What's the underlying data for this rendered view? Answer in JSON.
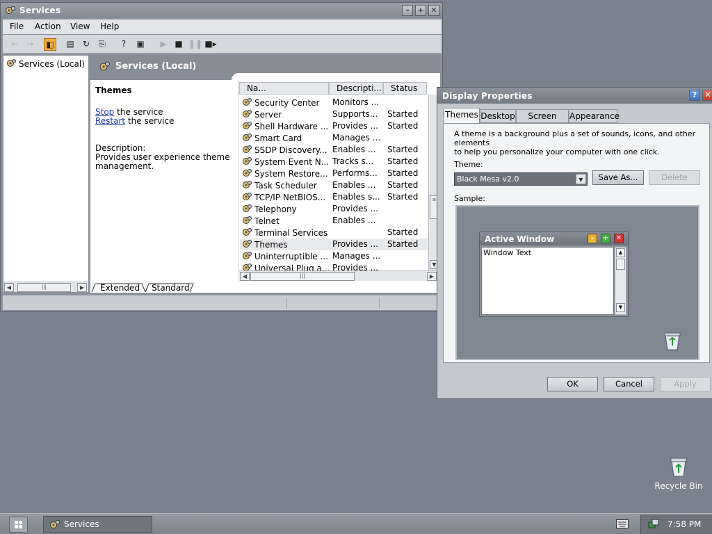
{
  "services": {
    "title": "Services",
    "menu": [
      "File",
      "Action",
      "View",
      "Help"
    ],
    "tree_root": "Services (Local)",
    "header_title": "Services (Local)",
    "detail": {
      "name": "Themes",
      "stop_link": "Stop",
      "stop_rest": " the service",
      "restart_link": "Restart",
      "restart_rest": " the service",
      "desc_label": "Description:",
      "desc_line1": "Provides user experience theme",
      "desc_line2": "management."
    },
    "columns": [
      "Na...",
      "Descripti...",
      "Status"
    ],
    "rows": [
      {
        "name": "Security Center",
        "desc": "Monitors ...",
        "status": ""
      },
      {
        "name": "Server",
        "desc": "Supports...",
        "status": "Started"
      },
      {
        "name": "Shell Hardware ...",
        "desc": "Provides ...",
        "status": "Started"
      },
      {
        "name": "Smart Card",
        "desc": "Manages ...",
        "status": ""
      },
      {
        "name": "SSDP Discovery...",
        "desc": "Enables ...",
        "status": "Started"
      },
      {
        "name": "System Event N...",
        "desc": "Tracks s...",
        "status": "Started"
      },
      {
        "name": "System Restore...",
        "desc": "Performs...",
        "status": "Started"
      },
      {
        "name": "Task Scheduler",
        "desc": "Enables ...",
        "status": "Started"
      },
      {
        "name": "TCP/IP NetBIOS...",
        "desc": "Enables s...",
        "status": "Started"
      },
      {
        "name": "Telephony",
        "desc": "Provides ...",
        "status": ""
      },
      {
        "name": "Telnet",
        "desc": "Enables ...",
        "status": ""
      },
      {
        "name": "Terminal Services",
        "desc": "",
        "status": "Started"
      },
      {
        "name": "Themes",
        "desc": "Provides ...",
        "status": "Started"
      },
      {
        "name": "Uninterruptible ...",
        "desc": "Manages ...",
        "status": ""
      },
      {
        "name": "Universal Plug a...",
        "desc": "Provides ...",
        "status": ""
      }
    ],
    "selected_row": "Themes",
    "tabs": [
      "Extended",
      "Standard"
    ]
  },
  "display_properties": {
    "title": "Display Properties",
    "tabs": [
      "Themes",
      "Desktop",
      "Screen Saver",
      "Appearance"
    ],
    "active_tab": "Themes",
    "intro_line1": "A theme is a background plus a set of sounds, icons, and other elements",
    "intro_line2": "to help you personalize your computer with one click.",
    "theme_label": "Theme:",
    "theme_value": "Black Mesa v2.0",
    "save_as": "Save As...",
    "delete": "Delete",
    "sample_label": "Sample:",
    "sample_active_title": "Active Window",
    "sample_window_text": "Window Text",
    "ok": "OK",
    "cancel": "Cancel",
    "apply": "Apply"
  },
  "desktop": {
    "recycle_bin": "Recycle Bin"
  },
  "taskbar": {
    "task_label": "Services",
    "clock": "7:58 PM"
  }
}
